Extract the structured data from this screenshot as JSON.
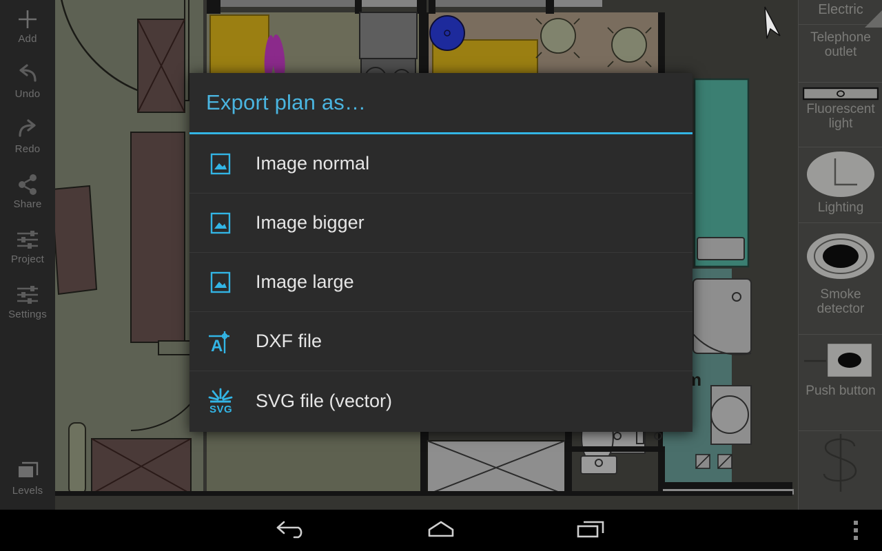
{
  "app": {
    "name": "floor-plan-editor",
    "accent_color": "#33b5e5",
    "dialog_bg": "#2b2b2b",
    "toolbar_bg": "#242424",
    "palette_bg": "#3a3a38"
  },
  "left_toolbar": {
    "items": [
      {
        "label": "Add",
        "icon": "plus-icon"
      },
      {
        "label": "Undo",
        "icon": "undo-arrow-icon"
      },
      {
        "label": "Redo",
        "icon": "redo-arrow-icon"
      },
      {
        "label": "Share",
        "icon": "share-nodes-icon"
      },
      {
        "label": "Project",
        "icon": "sliders-icon"
      },
      {
        "label": "Settings",
        "icon": "sliders-icon"
      },
      {
        "label": "Levels",
        "icon": "layers-stack-icon"
      }
    ]
  },
  "right_palette": {
    "category": "Electric",
    "items": [
      {
        "label": "Telephone outlet",
        "icon": "telephone-outlet-symbol"
      },
      {
        "label": "Fluorescent light",
        "icon": "fluorescent-light-symbol"
      },
      {
        "label": "Lighting",
        "icon": "lighting-symbol"
      },
      {
        "label": "Smoke detector",
        "icon": "smoke-detector-symbol"
      },
      {
        "label": "Push button",
        "icon": "push-button-symbol"
      },
      {
        "label": "",
        "icon": "dollar-sign-symbol"
      }
    ]
  },
  "dialog": {
    "title": "Export plan as…",
    "options": [
      {
        "label": "Image normal",
        "icon": "image-icon"
      },
      {
        "label": "Image bigger",
        "icon": "image-icon"
      },
      {
        "label": "Image large",
        "icon": "image-icon"
      },
      {
        "label": "DXF file",
        "icon": "dxf-file-icon"
      },
      {
        "label": "SVG file (vector)",
        "icon": "svg-file-icon"
      }
    ]
  },
  "navbar": {
    "back": "back-icon",
    "home": "home-icon",
    "recents": "recents-icon",
    "overflow": "overflow-menu-icon"
  },
  "plan": {
    "label_partial": "m",
    "colors": {
      "room_olive": "#5d6153",
      "room_taupe": "#7a6d5e",
      "room_teal": "#3b7f72",
      "room_teal_dark": "#4a6f6b",
      "furniture_brown": "#4a3a38",
      "furniture_gold": "#9b7f12",
      "furniture_purple": "#8b2a8b",
      "furniture_blue": "#1d2a9c",
      "furniture_gray": "#8e8e8e",
      "wall": "#141414",
      "background": "#343430"
    }
  }
}
